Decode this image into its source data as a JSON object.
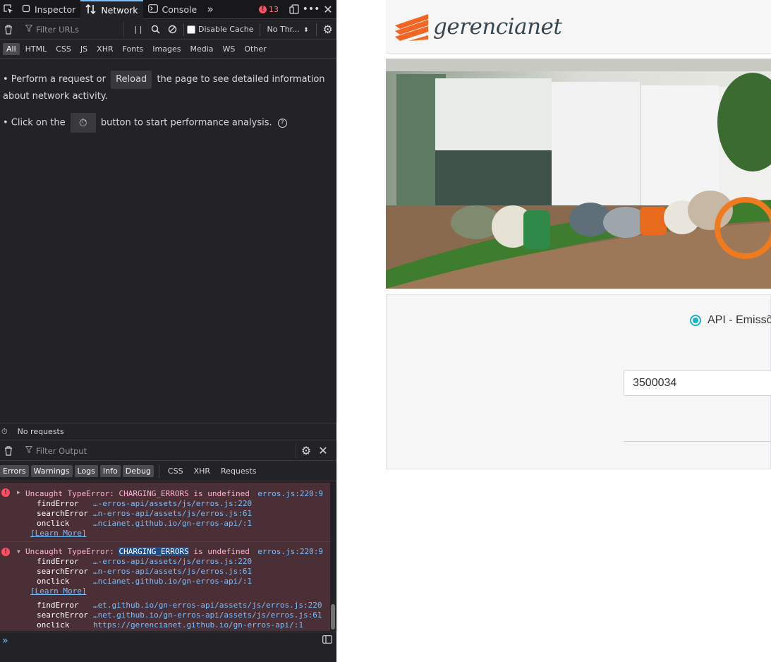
{
  "devtools": {
    "top_tabs": [
      "Inspector",
      "Network",
      "Console"
    ],
    "error_count": "13",
    "network": {
      "filter_placeholder": "Filter URLs",
      "disable_cache_label": "Disable Cache",
      "throttle_label": "No Thr...",
      "type_filters": [
        "All",
        "HTML",
        "CSS",
        "JS",
        "XHR",
        "Fonts",
        "Images",
        "Media",
        "WS",
        "Other"
      ],
      "empty_line1_before": "• Perform a request or",
      "reload_label": "Reload",
      "empty_line1_after": "the page to see detailed information about network activity.",
      "empty_line2_before": "• Click on the",
      "empty_line2_after": "button to start performance analysis.",
      "status_text": "No requests"
    },
    "console": {
      "filter_placeholder": "Filter Output",
      "level_filters": [
        "Errors",
        "Warnings",
        "Logs",
        "Info",
        "Debug"
      ],
      "other_filters": [
        "CSS",
        "XHR",
        "Requests"
      ],
      "messages": [
        {
          "prefix": "Uncaught TypeError: ",
          "highlight": "CHARGING_ERRORS",
          "suffix": " is undefined",
          "location": "erros.js:220:9",
          "trace": [
            {
              "fn": "findError",
              "src": "…-erros-api/assets/js/erros.js:220"
            },
            {
              "fn": "searchError",
              "src": "…n-erros-api/assets/js/erros.js:61"
            },
            {
              "fn": "onclick",
              "src": "…ncianet.github.io/gn-erros-api/:1"
            }
          ],
          "learn_more": "[Learn More]"
        },
        {
          "prefix": "Uncaught TypeError: ",
          "highlight": "CHARGING_ERRORS",
          "suffix": " is undefined",
          "location": "erros.js:220:9",
          "trace": [
            {
              "fn": "findError",
              "src": "…-erros-api/assets/js/erros.js:220"
            },
            {
              "fn": "searchError",
              "src": "…n-erros-api/assets/js/erros.js:61"
            },
            {
              "fn": "onclick",
              "src": "…ncianet.github.io/gn-erros-api/:1"
            }
          ],
          "learn_more": "[Learn More]",
          "expanded_trace": [
            {
              "fn": "findError",
              "src": "…et.github.io/gn-erros-api/assets/js/erros.js:220"
            },
            {
              "fn": "searchError",
              "src": "…net.github.io/gn-erros-api/assets/js/erros.js:61"
            },
            {
              "fn": "onclick",
              "src": "https://gerencianet.github.io/gn-erros-api/:1"
            }
          ]
        }
      ]
    }
  },
  "page": {
    "logo_text": "gerencianet",
    "brand_color": "#f26522",
    "accent_color": "#1ab4c6",
    "radio_label": "API - Emissõe",
    "code_value": "3500034"
  }
}
